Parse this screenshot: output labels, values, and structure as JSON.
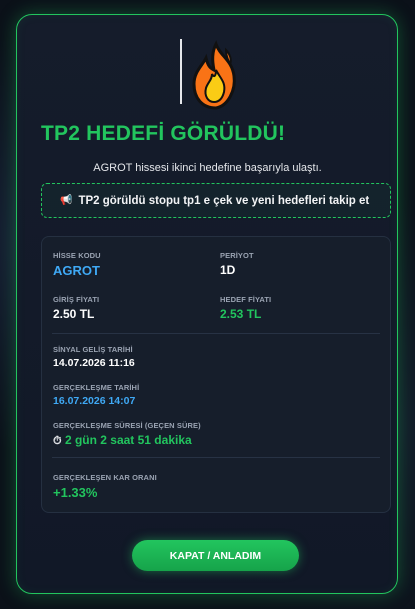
{
  "modal": {
    "title": "TP2 HEDEFİ GÖRÜLDÜ!",
    "subtitle": "AGROT hissesi ikinci hedefine başarıyla ulaştı.",
    "note_icon": "megaphone-icon",
    "note_text": "TP2 görüldü stopu tp1 e çek ve yeni hedefleri takip et",
    "hero_icon": "fire-icon"
  },
  "details": {
    "symbol_label": "HİSSE KODU",
    "symbol_value": "AGROT",
    "period_label": "PERİYOT",
    "period_value": "1D",
    "entry_label": "GİRİŞ FİYATI",
    "entry_value": "2.50 TL",
    "target_label": "HEDEF FİYATI",
    "target_value": "2.53 TL",
    "signal_date_label": "SİNYAL GELİŞ TARİHİ",
    "signal_date_value": "14.07.2026 11:16",
    "realized_date_label": "GERÇEKLEŞME TARİHİ",
    "realized_date_value": "16.07.2026 14:07",
    "duration_label": "GERÇEKLEŞME SÜRESİ (GEÇEN SÜRE)",
    "duration_icon": "stopwatch-icon",
    "duration_value": "2 gün 2 saat 51 dakika",
    "profit_label": "GERÇEKLEŞEN KAR ORANI",
    "profit_value": "+1.33%"
  },
  "actions": {
    "close_label": "KAPAT / ANLADIM"
  },
  "colors": {
    "accent": "#22c55e",
    "link_blue": "#3fa9f5",
    "background": "#111827"
  }
}
